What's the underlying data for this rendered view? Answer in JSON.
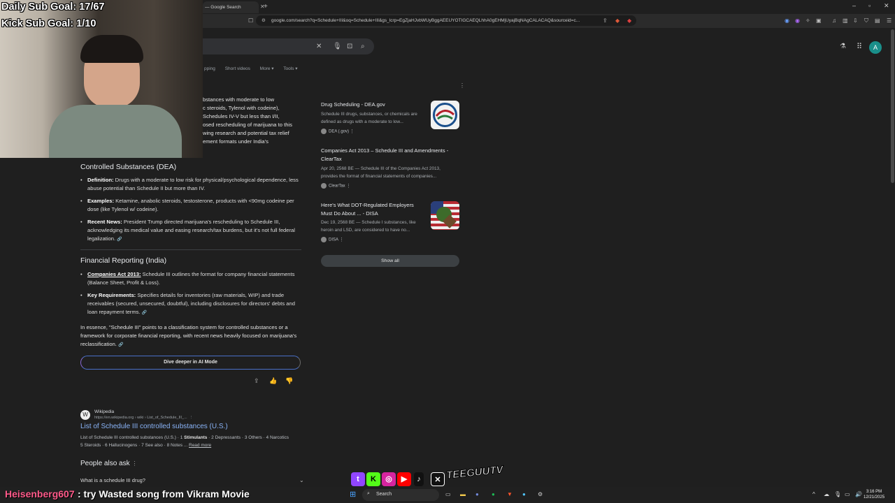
{
  "browser": {
    "tab_title": "— Google Search",
    "url": "google.com/search?q=Schedule+III&oq=Schedule+III&gs_lcrp=EgZjaHJvbWUyBggAEEUYOTIGCAEQLhhA0gEHMjUyajBqNAgCALACAQ&sourceid=c..."
  },
  "search": {
    "tabs": [
      "pping",
      "Short videos",
      "More ▾",
      "Tools ▾"
    ]
  },
  "overview": {
    "intro_lines": [
      "bstances with moderate to low",
      "c steroids, Tylenol with codeine),",
      "Schedules IV-V but less than I/II,",
      "osed rescheduling of marijuana to this",
      "wing research and potential tax relief",
      "ement formats under India's"
    ],
    "section1_title": "Controlled Substances (DEA)",
    "section1_items": [
      {
        "label": "Definition:",
        "text": " Drugs with a moderate to low risk for physical/psychological dependence, less abuse potential than Schedule II but more than IV."
      },
      {
        "label": "Examples:",
        "text": " Ketamine, anabolic steroids, testosterone, products with <90mg codeine per dose (like Tylenol w/ codeine)."
      },
      {
        "label": "Recent News:",
        "text": " President Trump directed marijuana's rescheduling to Schedule III, acknowledging its medical value and easing research/tax burdens, but it's not full federal legalization."
      }
    ],
    "section2_title": "Financial Reporting (India)",
    "section2_items": [
      {
        "label": "Companies Act 2013:",
        "text": " Schedule III outlines the format for company financial statements (Balance Sheet, Profit & Loss)."
      },
      {
        "label": "Key Requirements:",
        "text": " Specifies details for inventories (raw materials, WIP) and trade receivables (secured, unsecured, doubtful), including disclosures for directors' debts and loan repayment terms."
      }
    ],
    "summary": "In essence, \"Schedule III\" points to a classification system for controlled substances or a framework for corporate financial reporting, with recent news heavily focused on marijuana's reclassification.",
    "ai_mode_button": "Dive deeper in AI Mode"
  },
  "sources": [
    {
      "title": "Drug Scheduling - DEA.gov",
      "snippet": "Schedule III drugs, substances, or chemicals are defined as drugs with a moderate to low...",
      "site": "DEA (.gov)"
    },
    {
      "title": "Companies Act 2013 – Schedule III and Amendments - ClearTax",
      "snippet": "Apr 20, 2568 BE — Schedule III of the Companies Act 2013, provides the format of financial statements of companies...",
      "site": "ClearTax"
    },
    {
      "title": "Here's What DOT-Regulated Employers Must Do About ... - DISA",
      "snippet": "Dec 19, 2568 BE — Schedule I substances, like heroin and LSD, are considered to have no...",
      "site": "DISA"
    }
  ],
  "show_all": "Show all",
  "result": {
    "site": "Wikipedia",
    "url": "https://en.wikipedia.org › wiki › List_of_Schedule_III_...",
    "title": "List of Schedule III controlled substances (U.S.)",
    "snippet_a": "List of Schedule III controlled substances (U.S.) · 1 ",
    "snippet_b": "Stimulants",
    "snippet_c": " · 2 Depressants · 3 Others · 4 Narcotics",
    "snippet_d": "5 Steroids · 6 Hallucinogens · 7 See also · 8 Notes ... ",
    "read_more": "Read more"
  },
  "paa": {
    "title": "People also ask",
    "question": "What is a schedule III drug?"
  },
  "stream": {
    "sub_goal": "Daily Sub Goal: 17/67",
    "kick_goal": "Kick Sub Goal: 1/10",
    "chat_user": "Heisenberg607",
    "chat_msg": ": try Wasted song from Vikram Movie",
    "brand": "TEEGUUTV"
  },
  "taskbar": {
    "search": "Search",
    "time": "3:16 PM",
    "date": "12/21/2025"
  },
  "colors": {
    "link": "#8ab4f8",
    "avatar": "#1a8f8a"
  }
}
